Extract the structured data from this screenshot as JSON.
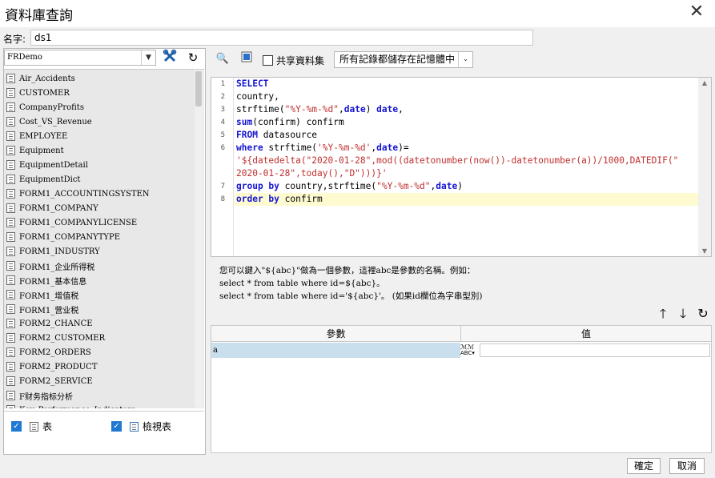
{
  "window": {
    "title": "資料庫查詢",
    "close_icon": "close-icon"
  },
  "name_field": {
    "label": "名字:",
    "value": "ds1"
  },
  "left": {
    "datasource": "FRDemo",
    "tables": [
      "Air_Accidents",
      "CUSTOMER",
      "CompanyProfits",
      "Cost_VS_Revenue",
      "EMPLOYEE",
      "Equipment",
      "EquipmentDetail",
      "EquipmentDict",
      "FORM1_ACCOUNTINGSYSTEN",
      "FORM1_COMPANY",
      "FORM1_COMPANYLICENSE",
      "FORM1_COMPANYTYPE",
      "FORM1_INDUSTRY",
      "FORM1_企业所得税",
      "FORM1_基本信息",
      "FORM1_增值税",
      "FORM1_营业税",
      "FORM2_CHANCE",
      "FORM2_CUSTOMER",
      "FORM2_ORDERS",
      "FORM2_PRODUCT",
      "FORM2_SERVICE",
      "F财务指标分析",
      "Key_Performance_Indicators"
    ],
    "filter_table_label": "表",
    "filter_view_label": "檢視表"
  },
  "toolbar": {
    "share_label": "共享資料集",
    "mode_value": "所有記錄都儲存在記憶體中"
  },
  "editor": {
    "lines": [
      {
        "num": "1",
        "parts": [
          {
            "t": "SELECT",
            "c": "kw"
          }
        ]
      },
      {
        "num": "2",
        "parts": [
          {
            "t": "country,",
            "c": ""
          }
        ]
      },
      {
        "num": "3",
        "parts": [
          {
            "t": "strftime(",
            "c": ""
          },
          {
            "t": "\"%Y-%m-%d\"",
            "c": "str"
          },
          {
            "t": ",",
            "c": ""
          },
          {
            "t": "date",
            "c": "kw"
          },
          {
            "t": ") ",
            "c": ""
          },
          {
            "t": "date",
            "c": "kw"
          },
          {
            "t": ",",
            "c": ""
          }
        ]
      },
      {
        "num": "4",
        "parts": [
          {
            "t": "sum",
            "c": "kw"
          },
          {
            "t": "(confirm) confirm",
            "c": ""
          }
        ]
      },
      {
        "num": "5",
        "parts": [
          {
            "t": "FROM",
            "c": "kw"
          },
          {
            "t": " datasource",
            "c": ""
          }
        ]
      },
      {
        "num": "6",
        "parts": [
          {
            "t": "where",
            "c": "kw"
          },
          {
            "t": " strftime(",
            "c": ""
          },
          {
            "t": "'%Y-%m-%d'",
            "c": "str"
          },
          {
            "t": ",",
            "c": ""
          },
          {
            "t": "date",
            "c": "kw"
          },
          {
            "t": ")=",
            "c": ""
          }
        ]
      },
      {
        "num": "",
        "parts": [
          {
            "t": "'${datedelta(\"2020-01-28\",mod((datetonumber(now())-datetonumber(a))/1000,DATEDIF(\"",
            "c": "str"
          }
        ]
      },
      {
        "num": "",
        "parts": [
          {
            "t": "2020-01-28\",today(),\"D\")))}'",
            "c": "str"
          }
        ]
      },
      {
        "num": "7",
        "parts": [
          {
            "t": "group by",
            "c": "kw"
          },
          {
            "t": " country,strftime(",
            "c": ""
          },
          {
            "t": "\"%Y-%m-%d\"",
            "c": "str"
          },
          {
            "t": ",",
            "c": ""
          },
          {
            "t": "date",
            "c": "kw"
          },
          {
            "t": ")",
            "c": ""
          }
        ]
      },
      {
        "num": "8",
        "parts": [
          {
            "t": "order by",
            "c": "kw"
          },
          {
            "t": " confirm",
            "c": ""
          }
        ],
        "highlight": true
      }
    ]
  },
  "hint": {
    "line1": "您可以鍵入\"${abc}\"做為一個參數，這裡abc是參數的名稱。例如：",
    "line2": "select * from table where id=${abc}。",
    "line3": "select * from table where id='${abc}'。 (如果id欄位為字串型別)"
  },
  "params": {
    "col_param": "參數",
    "col_value": "值",
    "rows": [
      {
        "name": "a",
        "type_icon": "abc-type-icon",
        "value": ""
      }
    ]
  },
  "footer": {
    "ok_label": "確定",
    "cancel_label": "取消"
  }
}
